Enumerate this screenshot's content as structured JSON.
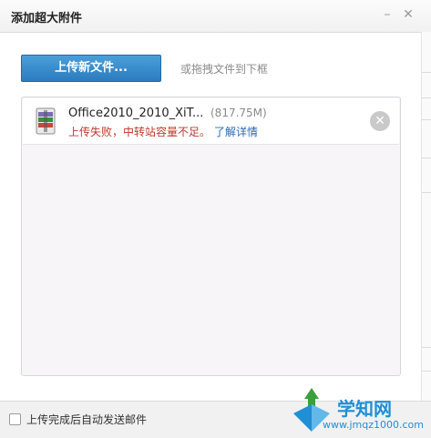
{
  "window": {
    "title": "添加超大附件",
    "minimize_glyph": "–",
    "close_glyph": "✕"
  },
  "toolbar": {
    "upload_label": "上传新文件...",
    "drag_hint": "或拖拽文件到下框"
  },
  "files": [
    {
      "icon": "winrar-archive-icon",
      "name": "Office2010_2010_XiT...",
      "size": "(817.75M)",
      "error": "上传失败，中转站容量不足。",
      "link": "了解详情",
      "remove_glyph": "✕"
    }
  ],
  "footer": {
    "auto_send_label": "上传完成后自动发送邮件",
    "auto_send_checked": false
  },
  "watermark": {
    "text": "学知网",
    "url": "www.jmqz1000.com"
  },
  "colors": {
    "accent": "#2b7cc0",
    "error": "#c0392b",
    "link": "#2a6ab1",
    "watermark": "#1f8fd6"
  }
}
